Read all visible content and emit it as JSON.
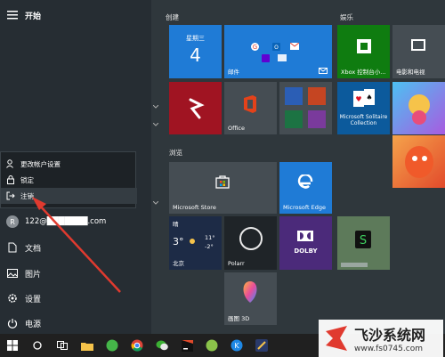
{
  "start": {
    "header_label": "开始",
    "user_menu": {
      "items": [
        {
          "label": "更改帐户设置",
          "icon": "person-settings-icon"
        },
        {
          "label": "锁定",
          "icon": "lock-icon"
        },
        {
          "label": "注销",
          "icon": "sign-out-icon"
        }
      ]
    },
    "nav": {
      "account_label": "122@███████.com",
      "documents_label": "文档",
      "pictures_label": "图片",
      "settings_label": "设置",
      "power_label": "电源"
    }
  },
  "tiles": {
    "group_create": "创建",
    "group_browse": "浏览",
    "group_play": "娱乐",
    "calendar": {
      "weekday": "星期三",
      "day": "4"
    },
    "mail": {
      "label": "邮件"
    },
    "office": {
      "label": "Office"
    },
    "xbox": {
      "label": "Xbox 控制台小..."
    },
    "movies": {
      "label": "电影和电视"
    },
    "solitaire": {
      "label": "Microsoft Solitaire Collection"
    },
    "store": {
      "label": "Microsoft Store"
    },
    "edge": {
      "label": "Microsoft Edge"
    },
    "weather": {
      "condition": "晴",
      "temp": "3°",
      "high": "11°",
      "low": "-2°",
      "city": "北京"
    },
    "polarr": {
      "label": "Polarr"
    },
    "dolby": {
      "label": "DOLBY"
    },
    "paint3d": {
      "label": "画图 3D"
    }
  },
  "watermark": {
    "title": "飞沙系统网",
    "url": "www.fs0745.com"
  },
  "colors": {
    "accent": "#1f7bd6",
    "arrow": "#e03a2f"
  }
}
